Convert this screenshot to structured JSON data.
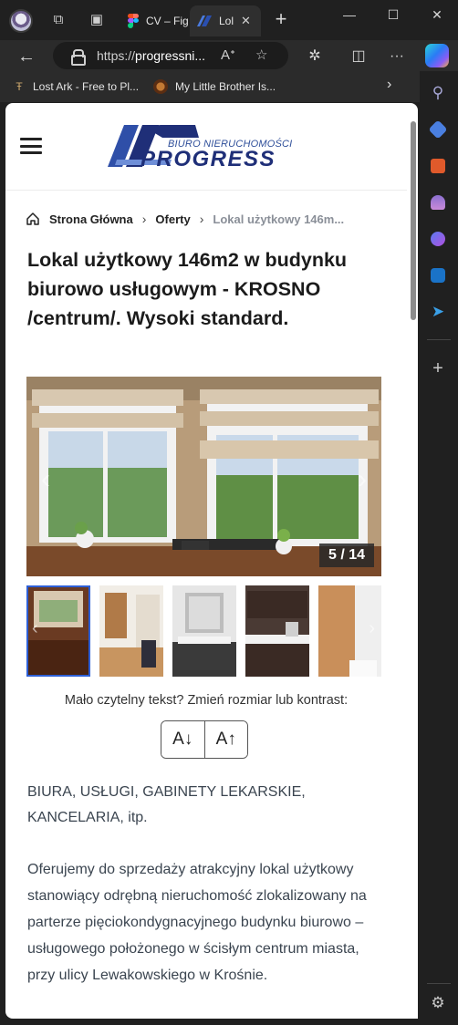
{
  "browser": {
    "tabs": [
      {
        "label": "CV – Fig",
        "active": false,
        "icon": "figma-icon"
      },
      {
        "label": "Lol",
        "active": true,
        "icon": "progress-favicon"
      }
    ],
    "url_prefix": "https://",
    "url_host": "progressni...",
    "favorites": [
      {
        "label": "Lost Ark - Free to Pl...",
        "icon": "lost-ark-icon"
      },
      {
        "label": "My Little Brother Is...",
        "icon": "wolf-icon"
      }
    ]
  },
  "site": {
    "logo_sub": "BIURO NIERUCHOMOŚCI",
    "logo_main": "PROGRESS",
    "breadcrumb": {
      "home": "Strona Główna",
      "offers": "Oferty",
      "current": "Lokal użytkowy 146m..."
    },
    "title": "Lokal użytkowy 146m2 w budynku biurowo usługowym - KROSNO /centrum/. Wysoki standard.",
    "gallery": {
      "counter": "5 / 14"
    },
    "accessibility": {
      "prompt": "Mało czytelny tekst? Zmień rozmiar lub kontrast:",
      "decrease_label": "A↓",
      "increase_label": "A↑"
    },
    "description": [
      "BIURA, USŁUGI, GABINETY LEKARSKIE, KANCELARIA, itp.",
      "Oferujemy do sprzedaży atrakcyjny lokal użytkowy stanowiący odrębną nieruchomość zlokalizowany na parterze pięciokondygnacyjnego budynku biurowo – usługowego położonego w ścisłym centrum miasta, przy ulicy Lewakowskiego w Krośnie."
    ]
  },
  "colors": {
    "brand_blue": "#1f2f78",
    "active_thumb_border": "#2d5fd6",
    "browser_bg": "#202020"
  }
}
